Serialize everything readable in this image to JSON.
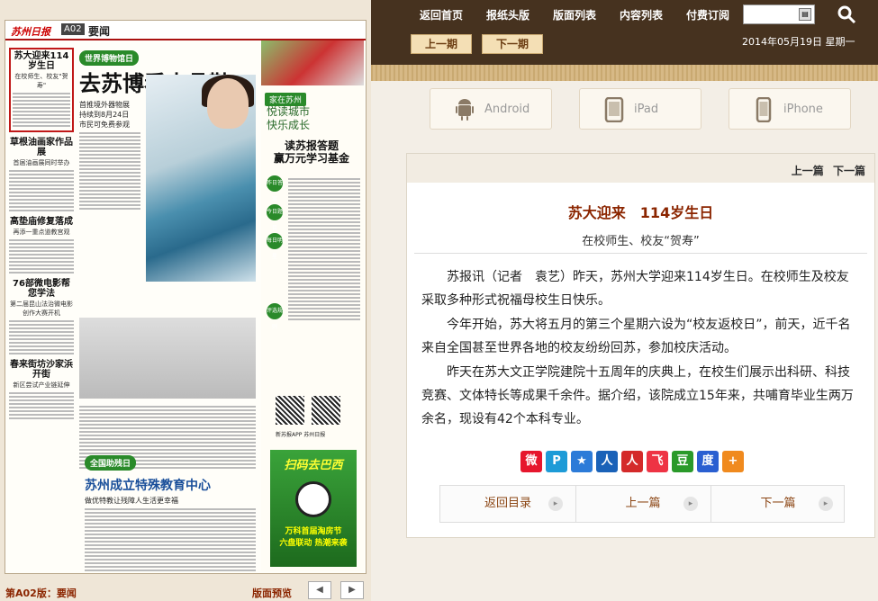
{
  "nav": {
    "links": [
      "返回首页",
      "报纸头版",
      "版面列表",
      "内容列表",
      "付费订阅"
    ],
    "search_placeholder": "",
    "prev_issue": "上一期",
    "next_issue": "下一期",
    "date": "2014年05月19日 星期一"
  },
  "apps": [
    {
      "label": "Android",
      "icon": "android-icon"
    },
    {
      "label": "iPad",
      "icon": "tablet-icon"
    },
    {
      "label": "iPhone",
      "icon": "phone-icon"
    }
  ],
  "newspaper": {
    "logo": "苏州日报",
    "edition": "A02",
    "section": "要闻",
    "left_column": [
      {
        "headline": "苏大迎来114岁生日",
        "sub": "在校师生、校友\"贺寿\""
      },
      {
        "headline": "草根油画家作品展",
        "sub": "首届油画展同时举办"
      },
      {
        "headline": "高垫庙修复落成",
        "sub": "再添一重点道教宫观"
      },
      {
        "headline": "76部微电影帮您学法",
        "sub": "第二届昆山法治微电影创作大赛开机"
      },
      {
        "headline": "春来街坊沙家浜开街",
        "sub": "新区尝试产业链延伸"
      }
    ],
    "museum_tag": "世界博物馆日",
    "main_headline": "去苏博看水晶鞋",
    "main_sub": "首推境外器物展\n持续到8月24日\n市民可免费参观",
    "city_tag": "家在苏州",
    "poem": "悦读城市\n快乐成长",
    "quiz": "读苏报答题\n赢万元学习基金",
    "circles": [
      "昨日答案",
      "今日题目",
      "每日明星",
      "评选规则"
    ],
    "qr_caption": "新苏报APP  苏州日报",
    "ad_title": "扫码去巴西",
    "ad_sub": "万科首届淘房节\n六盘联动 热潮来袭",
    "special_tag": "全国助残日",
    "special_head": "苏州成立特殊教育中心",
    "special_sub": "做优特教让残障人生活更幸福",
    "page_label": "第A02版：要闻",
    "preview_label": "版面预览"
  },
  "article": {
    "top_nav": [
      "上一篇",
      "下一篇"
    ],
    "title": "苏大迎来　114岁生日",
    "subtitle": "在校师生、校友“贺寿”",
    "paragraphs": [
      "苏报讯（记者　袁艺）昨天，苏州大学迎来114岁生日。在校师生及校友采取多种形式祝福母校生日快乐。",
      "今年开始，苏大将五月的第三个星期六设为“校友返校日”，前天，近千名来自全国甚至世界各地的校友纷纷回苏，参加校庆活动。",
      "昨天在苏大文正学院建院十五周年的庆典上，在校生们展示出科研、科技竞赛、文体特长等成果千余件。据介绍，该院成立15年来，共哺育毕业生两万余名，现设有42个本科专业。"
    ],
    "share_icons": [
      {
        "name": "weibo-icon",
        "glyph": "微",
        "color": "#e6162d"
      },
      {
        "name": "qzone-icon",
        "glyph": "P",
        "color": "#1d9bd7"
      },
      {
        "name": "star-icon",
        "glyph": "★",
        "color": "#2c7bd8"
      },
      {
        "name": "renren-icon",
        "glyph": "人",
        "color": "#1a62b8"
      },
      {
        "name": "kaixin-icon",
        "glyph": "人",
        "color": "#d42a2a"
      },
      {
        "name": "fetion-icon",
        "glyph": "飞",
        "color": "#e34"
      },
      {
        "name": "douban-icon",
        "glyph": "豆",
        "color": "#2a9a2a"
      },
      {
        "name": "baidu-icon",
        "glyph": "度",
        "color": "#2a5fd1"
      },
      {
        "name": "more-share-icon",
        "glyph": "+",
        "color": "#f08a1e"
      }
    ],
    "footer": [
      "返回目录",
      "上一篇",
      "下一篇"
    ]
  }
}
